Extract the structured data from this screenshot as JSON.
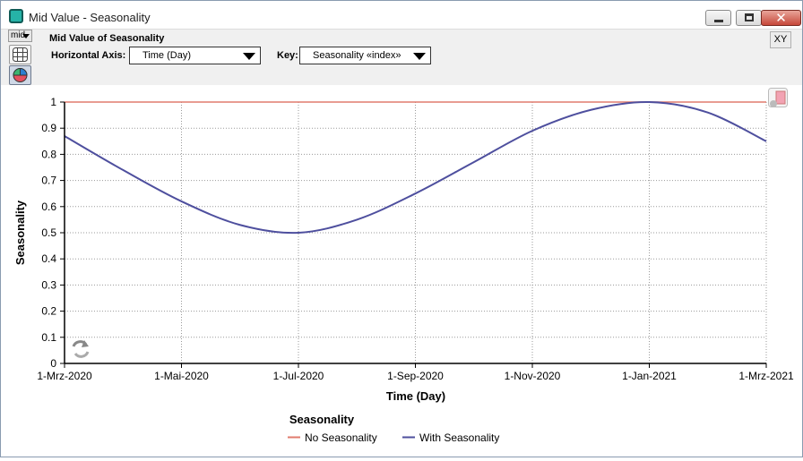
{
  "window": {
    "title": "Mid Value - Seasonality"
  },
  "toolbar": {
    "mid_label": "mid",
    "result_title": "Mid Value of Seasonality",
    "horizontal_axis_label": "Horizontal Axis:",
    "horizontal_axis_value": "Time (Day)",
    "key_label": "Key:",
    "key_value": "Seasonality «index»",
    "xy_label": "XY"
  },
  "colors": {
    "no_seasonality": "#e07b6e",
    "with_seasonality": "#4e4f9e",
    "grid": "#9a9a9a"
  },
  "chart_data": {
    "type": "line",
    "xlabel": "Time (Day)",
    "ylabel": "Seasonality",
    "legend_title": "Seasonality",
    "legend_position": "bottom",
    "grid": true,
    "ylim": [
      0,
      1
    ],
    "yticks": [
      "0",
      "0.1",
      "0.2",
      "0.3",
      "0.4",
      "0.5",
      "0.6",
      "0.7",
      "0.8",
      "0.9",
      "1"
    ],
    "xticks": [
      "1-Mrz-2020",
      "1-Mai-2020",
      "1-Jul-2020",
      "1-Sep-2020",
      "1-Nov-2020",
      "1-Jan-2021",
      "1-Mrz-2021"
    ],
    "x": [
      "1-Mrz-2020",
      "1-Apr-2020",
      "1-Mai-2020",
      "1-Jun-2020",
      "1-Jul-2020",
      "1-Aug-2020",
      "1-Sep-2020",
      "1-Okt-2020",
      "1-Nov-2020",
      "1-Dez-2020",
      "1-Jan-2021",
      "1-Feb-2021",
      "1-Mrz-2021"
    ],
    "series": [
      {
        "name": "No Seasonality",
        "color": "#e07b6e",
        "values": [
          1,
          1,
          1,
          1,
          1,
          1,
          1,
          1,
          1,
          1,
          1,
          1,
          1
        ]
      },
      {
        "name": "With Seasonality",
        "color": "#4e4f9e",
        "values": [
          0.87,
          0.74,
          0.62,
          0.53,
          0.5,
          0.55,
          0.65,
          0.77,
          0.89,
          0.97,
          1.0,
          0.96,
          0.85
        ]
      }
    ]
  }
}
